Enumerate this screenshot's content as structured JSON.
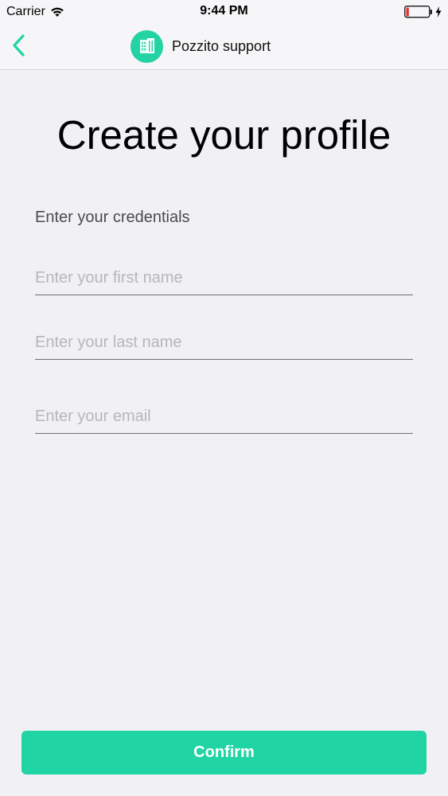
{
  "status_bar": {
    "carrier": "Carrier",
    "time": "9:44 PM",
    "icons": [
      "wifi-icon",
      "battery-icon",
      "charging-bolt-icon"
    ],
    "battery_level": 0.12
  },
  "nav": {
    "back_icon": "chevron-left-icon",
    "avatar_icon": "building-icon",
    "title": "Pozzito support"
  },
  "form": {
    "title": "Create your profile",
    "section_label": "Enter your credentials",
    "first_name": {
      "value": "",
      "placeholder": "Enter your first name"
    },
    "last_name": {
      "value": "",
      "placeholder": "Enter your last name"
    },
    "email": {
      "value": "",
      "placeholder": "Enter your email"
    },
    "confirm_label": "Confirm"
  },
  "colors": {
    "accent": "#21d4a4",
    "background": "#f0f0f5",
    "battery_low": "#e0322d"
  }
}
